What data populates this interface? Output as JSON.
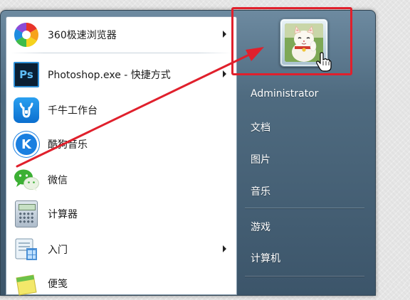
{
  "start_menu": {
    "programs": [
      {
        "label": "360极速浏览器",
        "icon": "360-browser-icon",
        "has_submenu": true
      },
      {
        "label": "Photoshop.exe - 快捷方式",
        "icon": "photoshop-icon",
        "has_submenu": true
      },
      {
        "label": "千牛工作台",
        "icon": "qianniu-icon",
        "has_submenu": false
      },
      {
        "label": "酷狗音乐",
        "icon": "kugou-music-icon",
        "has_submenu": false
      },
      {
        "label": "微信",
        "icon": "wechat-icon",
        "has_submenu": false
      },
      {
        "label": "计算器",
        "icon": "calculator-icon",
        "has_submenu": false
      },
      {
        "label": "入门",
        "icon": "getting-started-icon",
        "has_submenu": true
      },
      {
        "label": "便笺",
        "icon": "sticky-notes-icon",
        "has_submenu": false
      }
    ],
    "ps_icon_text": "Ps",
    "kugou_icon_text": "K",
    "right_pane": {
      "user_name": "Administrator",
      "items": [
        "文档",
        "图片",
        "音乐",
        "游戏",
        "计算机"
      ]
    }
  },
  "colors": {
    "highlight": "#e0202c",
    "menu_panel": "#4f6b80",
    "left_pane": "#ffffff"
  }
}
